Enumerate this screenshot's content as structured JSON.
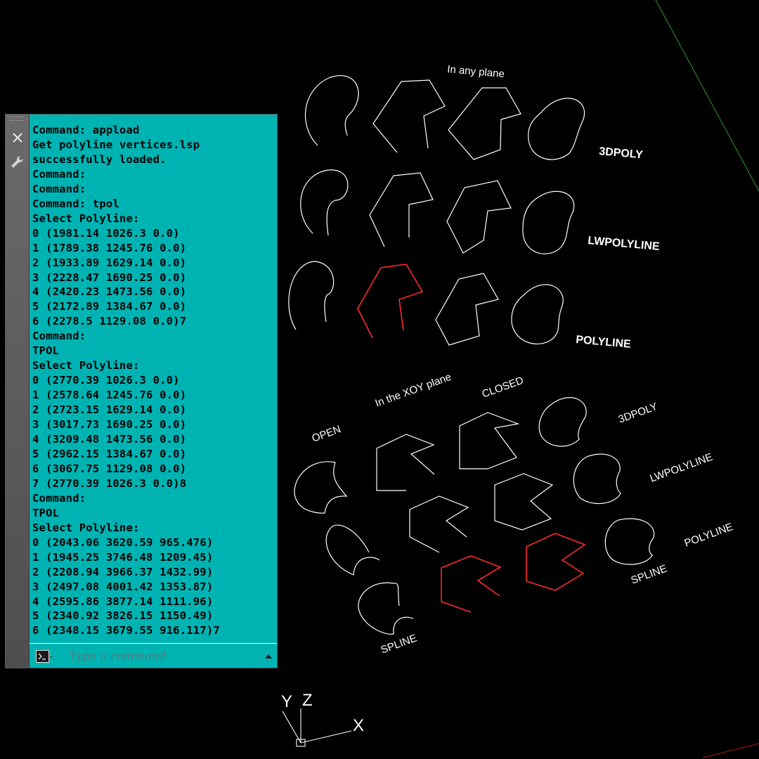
{
  "viewport": {
    "labels": {
      "any_plane": "In any plane",
      "xoy_plane": "In the XOY plane",
      "open": "OPEN",
      "closed": "CLOSED",
      "row_3dpoly": "3DPOLY",
      "row_lwpolyline": "LWPOLYLINE",
      "row_polyline": "POLYLINE",
      "xoy_3dpoly": "3DPOLY",
      "xoy_lwpolyline": "LWPOLYLINE",
      "xoy_polyline": "POLYLINE",
      "xoy_spline_right": "SPLINE",
      "xoy_spline_bottom": "SPLINE"
    },
    "ucs": {
      "y": "Y",
      "z": "Z",
      "x": "X"
    },
    "colors": {
      "line": "#ffffff",
      "selected": "#ff2a2a",
      "axis_green": "#2e9a2e",
      "axis_red": "#b01818"
    }
  },
  "command_window": {
    "history": [
      "Command: appload",
      "Get polyline vertices.lsp",
      "successfully loaded.",
      "Command:",
      "Command:",
      "Command: tpol",
      "Select Polyline:",
      "0 (1981.14 1026.3 0.0)",
      "1 (1789.38 1245.76 0.0)",
      "2 (1933.89 1629.14 0.0)",
      "3 (2228.47 1690.25 0.0)",
      "4 (2420.23 1473.56 0.0)",
      "5 (2172.89 1384.67 0.0)",
      "6 (2278.5 1129.08 0.0)7",
      "Command:",
      "TPOL",
      "Select Polyline:",
      "0 (2770.39 1026.3 0.0)",
      "1 (2578.64 1245.76 0.0)",
      "2 (2723.15 1629.14 0.0)",
      "3 (3017.73 1690.25 0.0)",
      "4 (3209.48 1473.56 0.0)",
      "5 (2962.15 1384.67 0.0)",
      "6 (3067.75 1129.08 0.0)",
      "7 (2770.39 1026.3 0.0)8",
      "Command:",
      "TPOL",
      "Select Polyline:",
      "0 (2043.06 3620.59 965.476)",
      "1 (1945.25 3746.48 1209.45)",
      "2 (2208.94 3966.37 1432.99)",
      "3 (2497.08 4001.42 1353.87)",
      "4 (2595.86 3877.14 1111.96)",
      "5 (2340.92 3826.15 1150.49)",
      "6 (2348.15 3679.55 916.117)7"
    ],
    "input_placeholder": "Type a command",
    "colors": {
      "background": "#00b3b3",
      "text": "#000000"
    }
  }
}
